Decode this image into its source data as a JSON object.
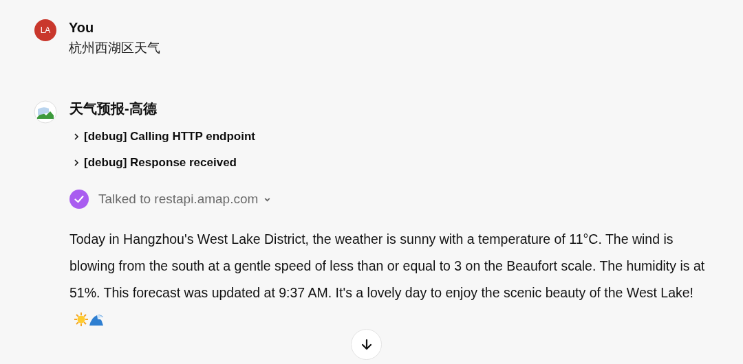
{
  "messages": [
    {
      "kind": "user",
      "avatar": "LA",
      "author": "You",
      "text": "杭州西湖区天气"
    },
    {
      "kind": "assistant",
      "author": "天气预报-高德",
      "debug": [
        {
          "label": "[debug] Calling HTTP endpoint",
          "expanded": false
        },
        {
          "label": "[debug] Response received",
          "expanded": false
        }
      ],
      "tool": {
        "label": "Talked to restapi.amap.com",
        "done": true
      },
      "text": "Today in Hangzhou's West Lake District, the weather is sunny with a temperature of 11°C. The wind is blowing from the south at a gentle speed of less than or equal to 3 on the Beaufort scale. The humidity is at 51%. This forecast was updated at 9:37 AM. It's a lovely day to enjoy the scenic beauty of the West Lake!"
    }
  ]
}
